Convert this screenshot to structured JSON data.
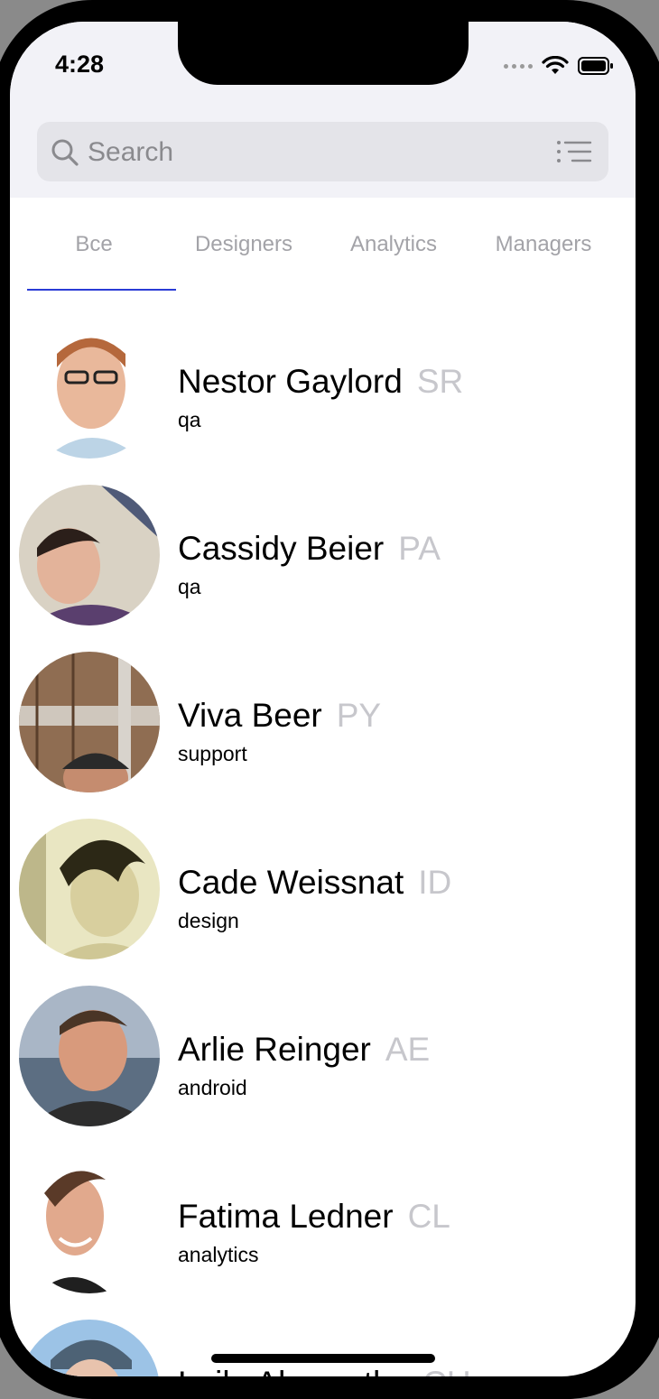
{
  "status_bar": {
    "time": "4:28"
  },
  "search": {
    "placeholder": "Search"
  },
  "tabs": [
    {
      "label": "Все",
      "active": true
    },
    {
      "label": "Designers",
      "active": false
    },
    {
      "label": "Analytics",
      "active": false
    },
    {
      "label": "Managers",
      "active": false
    }
  ],
  "colors": {
    "accent": "#2a3bd6",
    "tab_inactive": "#a3a3a8",
    "tag": "#c7c7cc"
  },
  "people": [
    {
      "name": "Nestor Gaylord",
      "tag": "SR",
      "department": "qa"
    },
    {
      "name": "Cassidy Beier",
      "tag": "PA",
      "department": "qa"
    },
    {
      "name": "Viva Beer",
      "tag": "PY",
      "department": "support"
    },
    {
      "name": "Cade Weissnat",
      "tag": "ID",
      "department": "design"
    },
    {
      "name": "Arlie Reinger",
      "tag": "AE",
      "department": "android"
    },
    {
      "name": "Fatima Ledner",
      "tag": "CL",
      "department": "analytics"
    },
    {
      "name": "Leila Abernathy",
      "tag": "CU",
      "department": ""
    }
  ]
}
